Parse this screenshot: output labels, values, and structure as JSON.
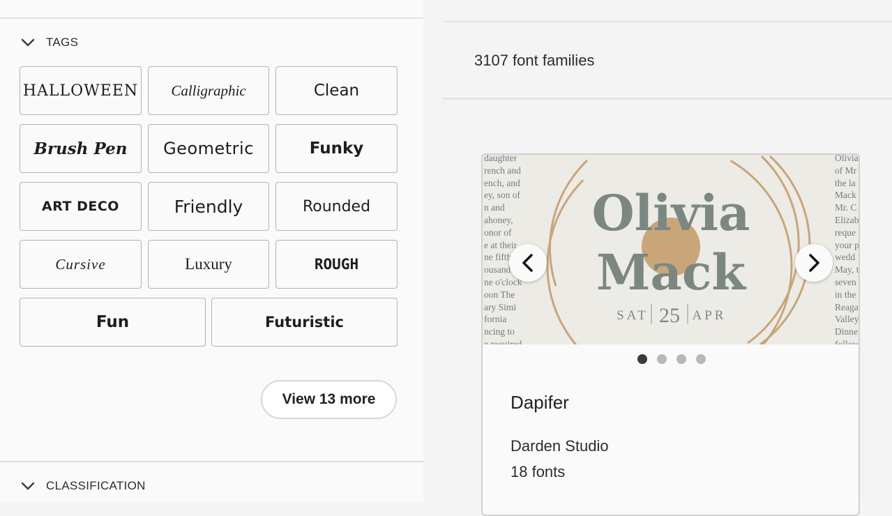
{
  "filters": {
    "tags_title": "TAGS",
    "classification_title": "CLASSIFICATION",
    "tags": [
      "HALLOWEEN",
      "Calligraphic",
      "Clean",
      "Brush Pen",
      "Geometric",
      "Funky",
      "ART DECO",
      "Friendly",
      "Rounded",
      "Cursive",
      "Luxury",
      "ROUGH",
      "Fun",
      "Futuristic"
    ],
    "view_more_label": "View 13 more"
  },
  "results": {
    "count_text": "3107 font families",
    "card": {
      "preview": {
        "title_line1": "Olivia",
        "title_line2": "Mack",
        "date_day": "SAT",
        "date_num": "25",
        "date_month": "APR",
        "left_text": "daughter\nrench and\nench, and\ney, son of\nn and\nahoney,\nonor of\ne at their\nne fifth\nousand\nne o'clock\noon The\nary Simi\nfornia\nncing to\ne required",
        "right_text": "Olivia\nof Mr\nthe la\nMack\nMr. C\nElizab\nreque\nyour p\nwedd\nMay, t\nseven\nin the\nReaga\nValley\nDinne\nfollow"
      },
      "slide_count": 4,
      "active_slide": 1,
      "family_name": "Dapifer",
      "foundry": "Darden Studio",
      "fonts_count": "18 fonts"
    }
  },
  "colors": {
    "accent_gold": "#c9a57a",
    "preview_text_gray": "#7c8781",
    "preview_bg": "#ecebe6"
  }
}
